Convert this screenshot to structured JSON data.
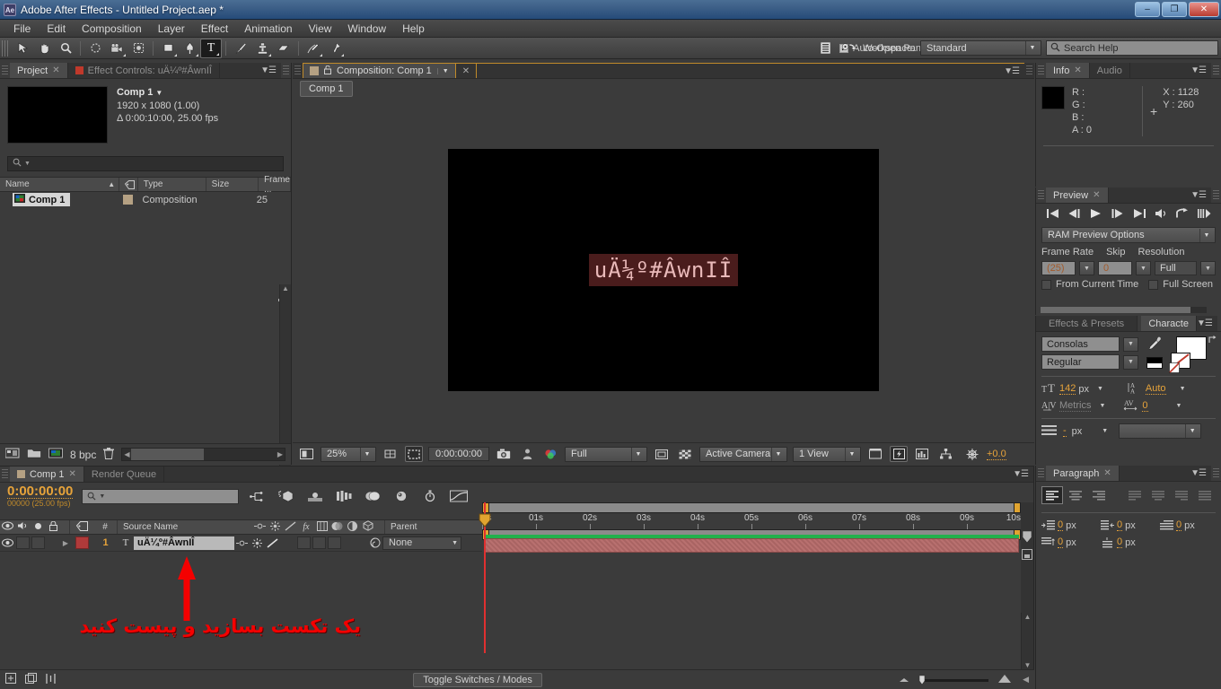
{
  "window": {
    "title": "Adobe After Effects - Untitled Project.aep *",
    "app_badge": "Ae",
    "minimize": "–",
    "maximize": "❐",
    "close": "✕"
  },
  "menu": [
    "File",
    "Edit",
    "Composition",
    "Layer",
    "Effect",
    "Animation",
    "View",
    "Window",
    "Help"
  ],
  "toolbar": {
    "tools": [
      {
        "name": "selection-tool",
        "glyph": "➤",
        "active": false
      },
      {
        "name": "hand-tool",
        "glyph": "✋",
        "active": false
      },
      {
        "name": "zoom-tool",
        "glyph": "🔍",
        "active": false
      },
      {
        "name": "rotation-tool",
        "glyph": "↻",
        "active": false
      },
      {
        "name": "camera-tool",
        "glyph": "🎥",
        "active": false
      },
      {
        "name": "pan-behind-tool",
        "glyph": "✦",
        "active": false
      },
      {
        "name": "shape-tool",
        "glyph": "■",
        "active": false
      },
      {
        "name": "pen-tool",
        "glyph": "✒",
        "active": false
      },
      {
        "name": "type-tool",
        "glyph": "T",
        "active": true
      },
      {
        "name": "brush-tool",
        "glyph": "╱",
        "active": false
      },
      {
        "name": "clone-stamp-tool",
        "glyph": "⚓",
        "active": false
      },
      {
        "name": "eraser-tool",
        "glyph": "▱",
        "active": false
      },
      {
        "name": "roto-brush-tool",
        "glyph": "✒",
        "active": false
      },
      {
        "name": "puppet-pin-tool",
        "glyph": "📌",
        "active": false
      }
    ],
    "auto_open_panels": "Auto-Open Panels",
    "auto_open_checked": true,
    "workspace_label": "Workspace:",
    "workspace_value": "Standard",
    "search_help_placeholder": "Search Help"
  },
  "project_panel": {
    "tabs": [
      {
        "label": "Project",
        "active": true,
        "closable": true
      },
      {
        "label": "Effect Controls: uÄ¼º#ÂwnIÎ",
        "active": false,
        "closable": false
      }
    ],
    "comp_name": "Comp 1",
    "comp_dims": "1920 x 1080 (1.00)",
    "comp_duration": "Δ 0:00:10:00, 25.00 fps",
    "search_placeholder": "",
    "columns": [
      "Name",
      "Type",
      "Size",
      "Frame ..."
    ],
    "rows": [
      {
        "name": "Comp 1",
        "type": "Composition",
        "size": "",
        "frame": "25"
      }
    ],
    "bit_depth": "8 bpc"
  },
  "comp_panel": {
    "tab_title": "Composition: Comp 1",
    "breadcrumb": "Comp 1",
    "text_layer_content": "uÄ¼º#ÂwnIÎ",
    "zoom": "25%",
    "time": "0:00:00:00",
    "resolution": "Full",
    "camera": "Active Camera",
    "views": "1 View",
    "exposure": "+0.0"
  },
  "info_panel": {
    "tabs": [
      {
        "label": "Info",
        "active": true,
        "closable": true
      },
      {
        "label": "Audio",
        "active": false,
        "closable": false
      }
    ],
    "r": "R :",
    "g": "G :",
    "b": "B :",
    "a": "A : 0",
    "x": "X : 1128",
    "y": "Y : 260"
  },
  "preview_panel": {
    "tab": "Preview",
    "transport": [
      "first-frame",
      "prev-frame",
      "play",
      "next-frame",
      "last-frame",
      "audio",
      "ram-preview",
      "loop"
    ],
    "ram_preview_options": "RAM Preview Options",
    "frame_rate_label": "Frame Rate",
    "frame_rate_value": "(25)",
    "skip_label": "Skip",
    "skip_value": "0",
    "resolution_label": "Resolution",
    "resolution_value": "Full",
    "from_current_time": "From Current Time",
    "full_screen": "Full Screen"
  },
  "character_panel": {
    "tabs": [
      {
        "label": "Effects & Presets",
        "active": false
      },
      {
        "label": "Characte",
        "active": true
      }
    ],
    "font_family": "Consolas",
    "font_style": "Regular",
    "font_size": "142",
    "font_size_unit": "px",
    "leading": "Auto",
    "kerning": "Metrics",
    "tracking": "0",
    "stroke_width": "-",
    "stroke_unit": "px",
    "px_label": "px"
  },
  "paragraph_panel": {
    "tab": "Paragraph",
    "align_buttons": [
      "align-left",
      "align-center",
      "align-right",
      "justify-last-left",
      "justify-last-center",
      "justify-last-right",
      "justify-all"
    ],
    "active_align": 0,
    "indent_left": "0",
    "indent_right": "0",
    "indent_first": "0",
    "space_before": "0",
    "space_after": "0",
    "unit": "px"
  },
  "timeline": {
    "tabs": [
      {
        "label": "Comp 1",
        "active": true,
        "closable": true
      },
      {
        "label": "Render Queue",
        "active": false,
        "closable": false
      }
    ],
    "current_time": "0:00:00:00",
    "frame_info": "00000 (25.00 fps)",
    "search_placeholder": "",
    "columns": [
      "#",
      "Source Name",
      "Parent"
    ],
    "layers": [
      {
        "index": "1",
        "source_name": "uÄ¼º#ÂwnIÎ",
        "type_icon": "T",
        "parent": "None",
        "label_color": "#b03a3a"
      }
    ],
    "ruler_ticks": [
      "0s",
      "01s",
      "02s",
      "03s",
      "04s",
      "05s",
      "06s",
      "07s",
      "08s",
      "09s",
      "10s"
    ],
    "toggle_switches_modes": "Toggle Switches / Modes"
  },
  "annotation": {
    "text": "یک تکست بسازید و پیست کنید",
    "arrow_color": "#f40000"
  },
  "colors": {
    "accent_orange": "#e7a33a",
    "panel_bg": "#3b3b3b",
    "layer_red": "#b03a3a",
    "selection_red": "#4a1c1c"
  }
}
